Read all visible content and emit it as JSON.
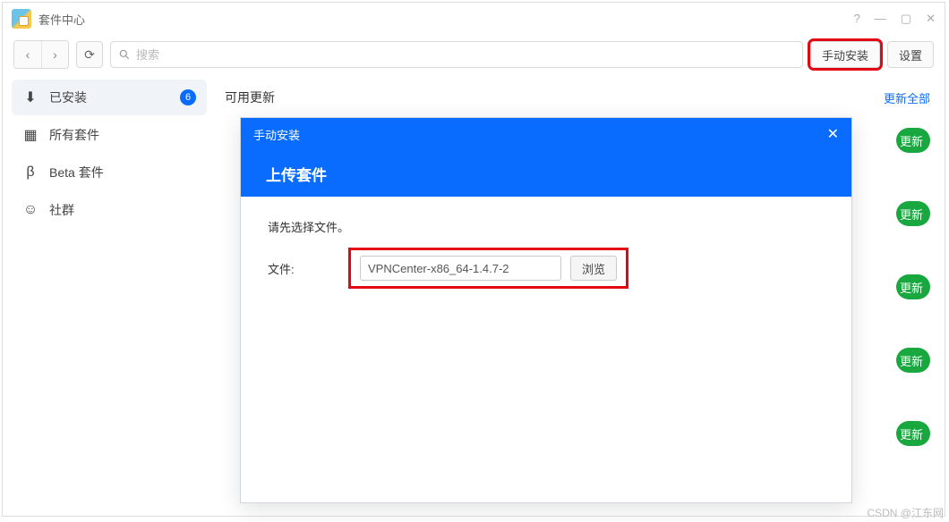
{
  "window": {
    "title": "套件中心"
  },
  "toolbar": {
    "search_placeholder": "搜索",
    "manual_install": "手动安装",
    "settings": "设置"
  },
  "sidebar": {
    "items": [
      {
        "icon": "download",
        "label": "已安装",
        "badge": "6"
      },
      {
        "icon": "grid",
        "label": "所有套件"
      },
      {
        "icon": "beta",
        "label": "Beta 套件"
      },
      {
        "icon": "community",
        "label": "社群"
      }
    ]
  },
  "content": {
    "section_title": "可用更新",
    "update_all": "更新全部",
    "update_label": "更新"
  },
  "modal": {
    "header": "手动安装",
    "title": "上传套件",
    "hint": "请先选择文件。",
    "file_label": "文件:",
    "file_value": "VPNCenter-x86_64-1.4.7-2",
    "browse": "浏览"
  },
  "watermark": "CSDN @江东网"
}
